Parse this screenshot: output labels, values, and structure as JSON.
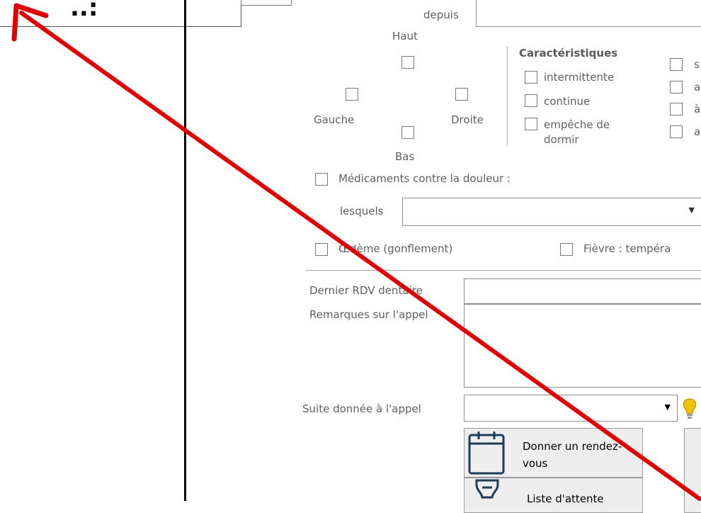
{
  "top_left_box": {
    "text": "..:"
  },
  "pain": {
    "depuis_label": "depuis",
    "directions": {
      "haut": "Haut",
      "gauche": "Gauche",
      "droite": "Droite",
      "bas": "Bas"
    },
    "characteristics": {
      "title": "Caractéristiques",
      "items": [
        "intermittente",
        "continue",
        "empêche de dormir"
      ]
    },
    "right_partial_labels": [
      "s",
      "a",
      "à",
      "a"
    ]
  },
  "medication": {
    "checkbox_label": "Médicaments contre la douleur :",
    "which_label": "lesquels"
  },
  "symptoms": {
    "oedema_label": "Œdème (gonflement)",
    "fever_label": "Fièvre : tempéra"
  },
  "form": {
    "last_appointment_label": "Dernier RDV dentaire",
    "call_remarks_label": "Remarques sur l'appel",
    "follow_up_label": "Suite donnée à l'appel"
  },
  "actions": {
    "give_appointment": "Donner un rendez-vous",
    "waiting_list": "Liste d'attente"
  },
  "colors": {
    "arrow": "#e00000",
    "lightbulb": "#f2c200"
  }
}
